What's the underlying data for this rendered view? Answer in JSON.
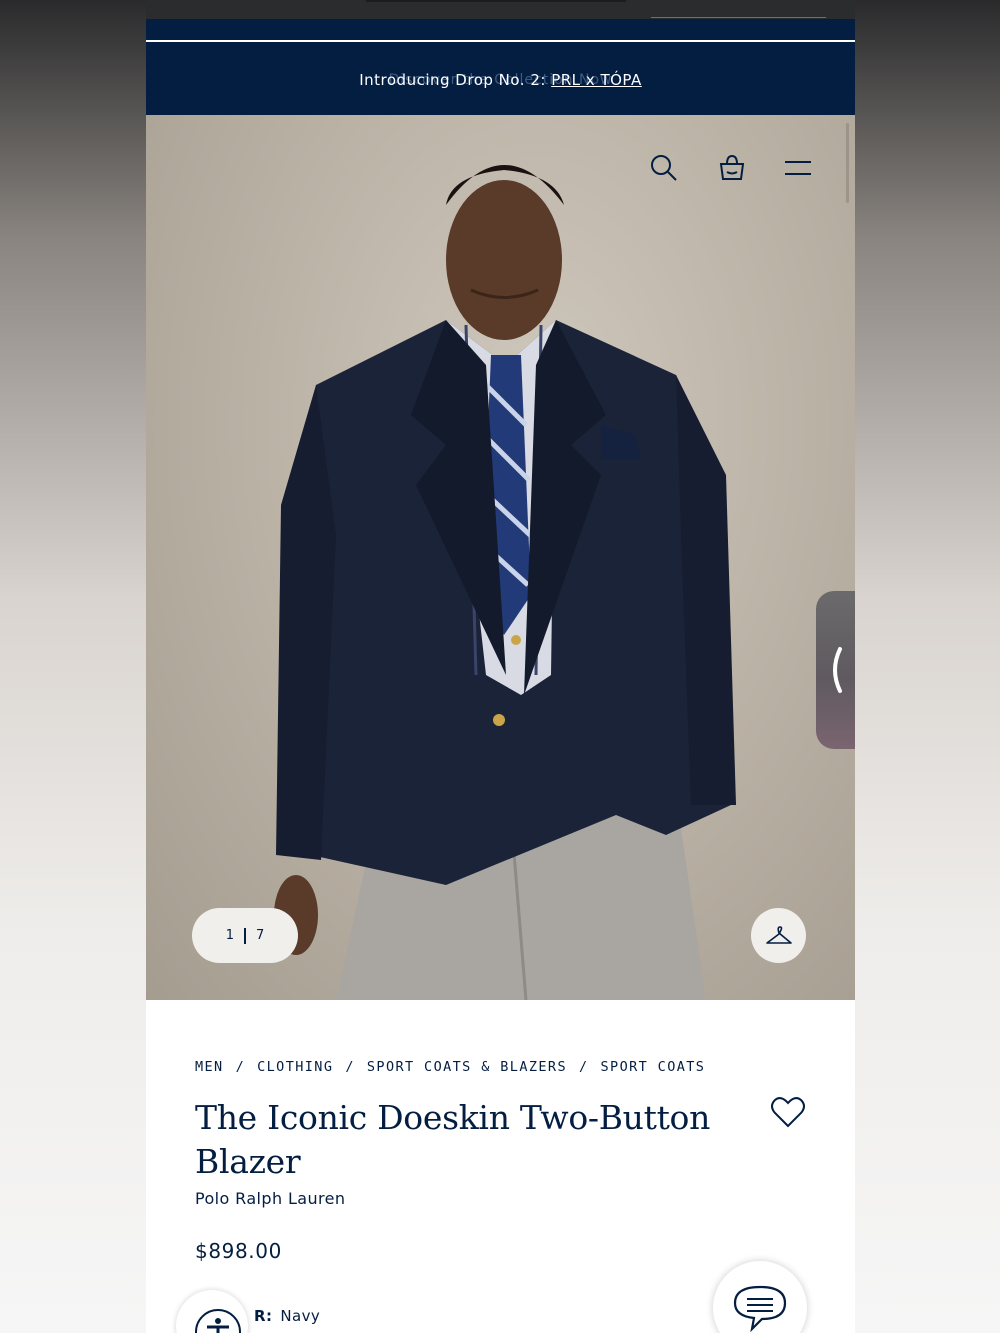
{
  "promo": {
    "ghost_text": "Discover the Collection Now",
    "prefix": "Introducing Drop No. 2: ",
    "link": "PRL x TÓPA"
  },
  "header_icons": [
    "search-icon",
    "shopping-bag-icon",
    "menu-icon"
  ],
  "gallery": {
    "current": "1",
    "total": "7",
    "side_tab_icon": "chevron-left-icon",
    "hanger_icon": "hanger-icon"
  },
  "breadcrumb": [
    "MEN",
    "CLOTHING",
    "SPORT COATS & BLAZERS",
    "SPORT COATS"
  ],
  "product": {
    "title": "The Iconic Doeskin Two-Button Blazer",
    "brand": "Polo Ralph Lauren",
    "price": "$898.00",
    "color_label": "R:",
    "color_value": "Navy"
  },
  "colors": {
    "navy": "#041e42",
    "white": "#ffffff"
  }
}
